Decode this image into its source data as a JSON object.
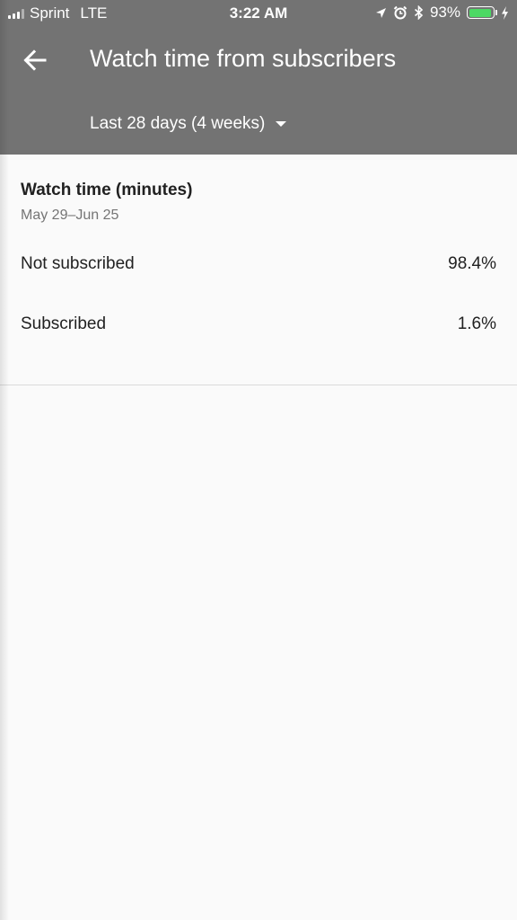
{
  "status_bar": {
    "carrier": "Sprint",
    "network": "LTE",
    "time": "3:22 AM",
    "battery_percent_label": "93%",
    "battery_level": 0.93,
    "icons": [
      "signal-bars-icon",
      "location-arrow-icon",
      "alarm-clock-icon",
      "bluetooth-icon",
      "battery-icon",
      "charging-bolt-icon"
    ]
  },
  "header": {
    "title": "Watch time from subscribers",
    "period": "Last 28 days (4 weeks)",
    "back_icon": "arrow-left-icon",
    "background_color": "#737373"
  },
  "card": {
    "title": "Watch time (minutes)",
    "date_range": "May 29–Jun 25",
    "rows": [
      {
        "label": "Not subscribed",
        "value": "98.4%"
      },
      {
        "label": "Subscribed",
        "value": "1.6%"
      }
    ]
  },
  "colors": {
    "battery_fill": "#4cd964",
    "page_background": "#fafafa"
  }
}
